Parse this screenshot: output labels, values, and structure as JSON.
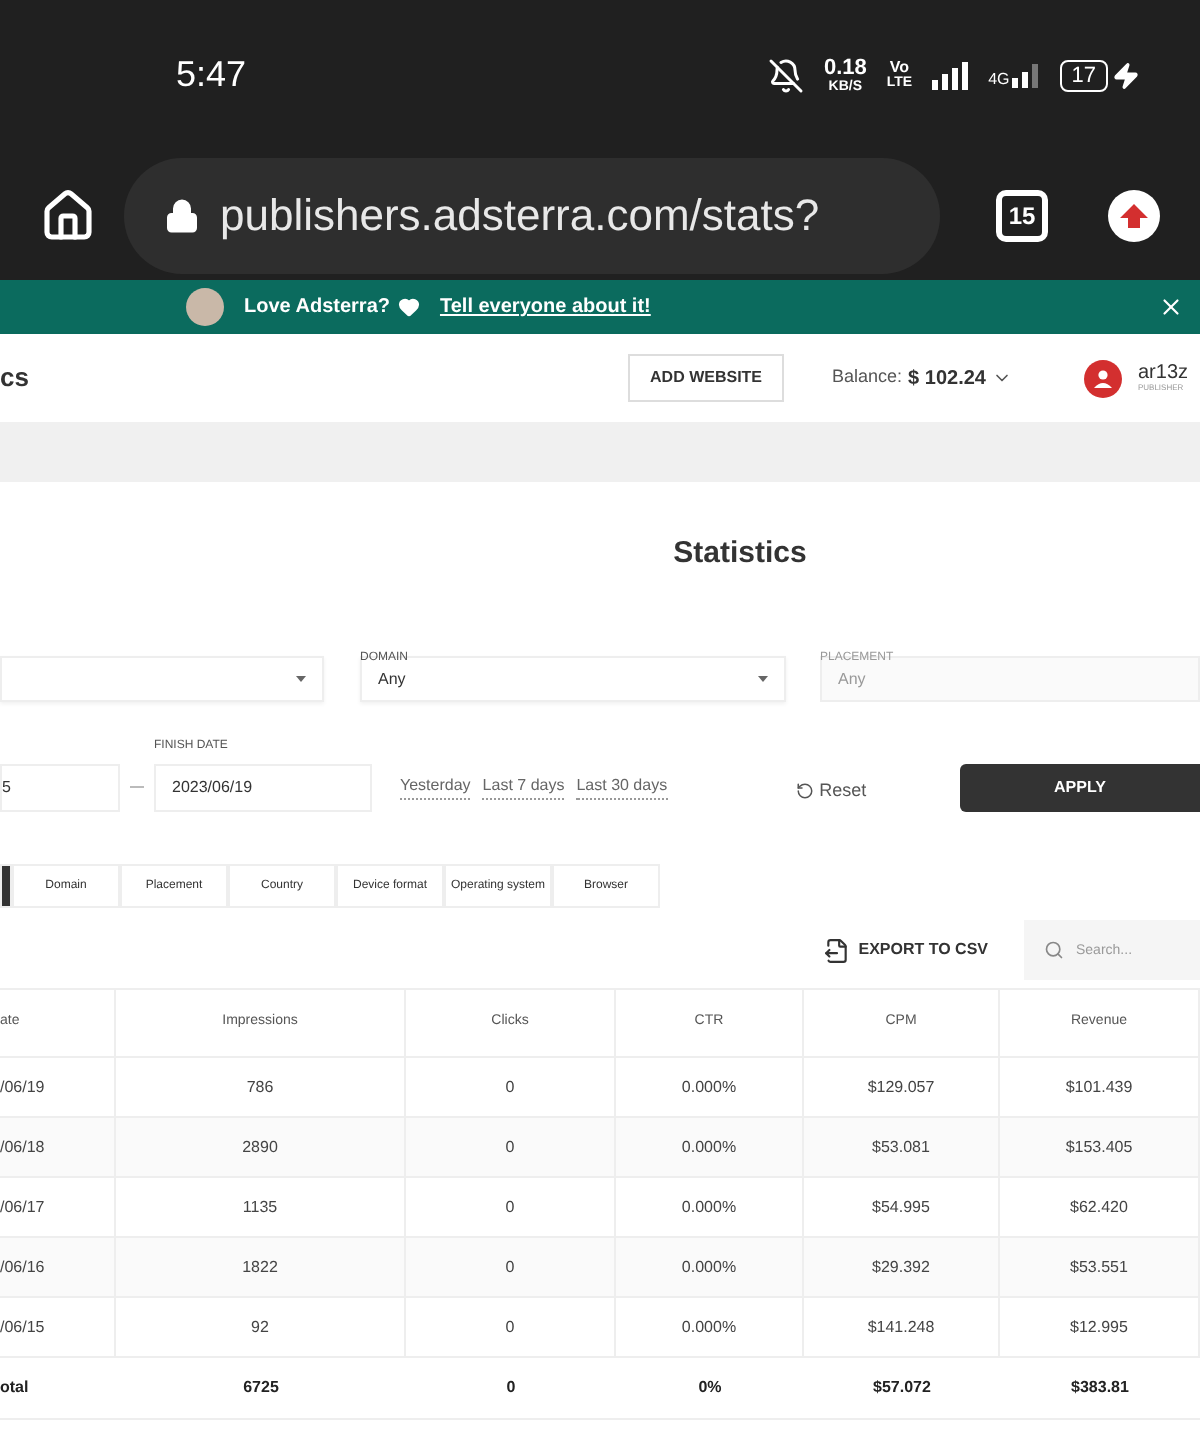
{
  "status_bar": {
    "time": "5:47",
    "speed_value": "0.18",
    "speed_unit": "KB/S",
    "volte_top": "Vo",
    "volte_bottom": "LTE",
    "network": "4G",
    "battery": "17"
  },
  "browser": {
    "url": "publishers.adsterra.com/stats?",
    "tab_count": "15"
  },
  "banner": {
    "text": "Love Adsterra?",
    "link": "Tell everyone about it!"
  },
  "header": {
    "title": "cs",
    "add_website": "ADD WEBSITE",
    "balance_label": "Balance:",
    "balance_value": "$ 102.24",
    "user_name": "ar13z",
    "user_role": "PUBLISHER"
  },
  "page_title": "Statistics",
  "filters": [
    {
      "disabled": false
    },
    {
      "label": "DOMAIN",
      "value": "Any",
      "disabled": false
    },
    {
      "label": "PLACEMENT",
      "value": "Any",
      "disabled": true
    }
  ],
  "dates": {
    "start": "5",
    "finish_label": "FINISH DATE",
    "finish": "2023/06/19",
    "presets": [
      "Yesterday",
      "Last 7 days",
      "Last 30 days"
    ],
    "reset": "Reset",
    "apply": "APPLY"
  },
  "tabs": [
    {
      "selected": true
    },
    {
      "label": "Domain",
      "selected": false
    },
    {
      "label": "Placement",
      "selected": false
    },
    {
      "label": "Country",
      "selected": false
    },
    {
      "label": "Device format",
      "selected": false
    },
    {
      "label": "Operating system",
      "selected": false
    },
    {
      "label": "Browser",
      "selected": false
    }
  ],
  "export": "EXPORT TO CSV",
  "search": {
    "placeholder": "Search..."
  },
  "table": {
    "columns": [
      "ate",
      "Impressions",
      "Clicks",
      "CTR",
      "CPM",
      "Revenue"
    ],
    "rows": [
      [
        "/06/19",
        "786",
        "0",
        "0.000%",
        "$129.057",
        "$101.439"
      ],
      [
        "/06/18",
        "2890",
        "0",
        "0.000%",
        "$53.081",
        "$153.405"
      ],
      [
        "/06/17",
        "1135",
        "0",
        "0.000%",
        "$54.995",
        "$62.420"
      ],
      [
        "/06/16",
        "1822",
        "0",
        "0.000%",
        "$29.392",
        "$53.551"
      ],
      [
        "/06/15",
        "92",
        "0",
        "0.000%",
        "$141.248",
        "$12.995"
      ]
    ],
    "total": [
      "otal",
      "6725",
      "0",
      "0%",
      "$57.072",
      "$383.81"
    ]
  }
}
